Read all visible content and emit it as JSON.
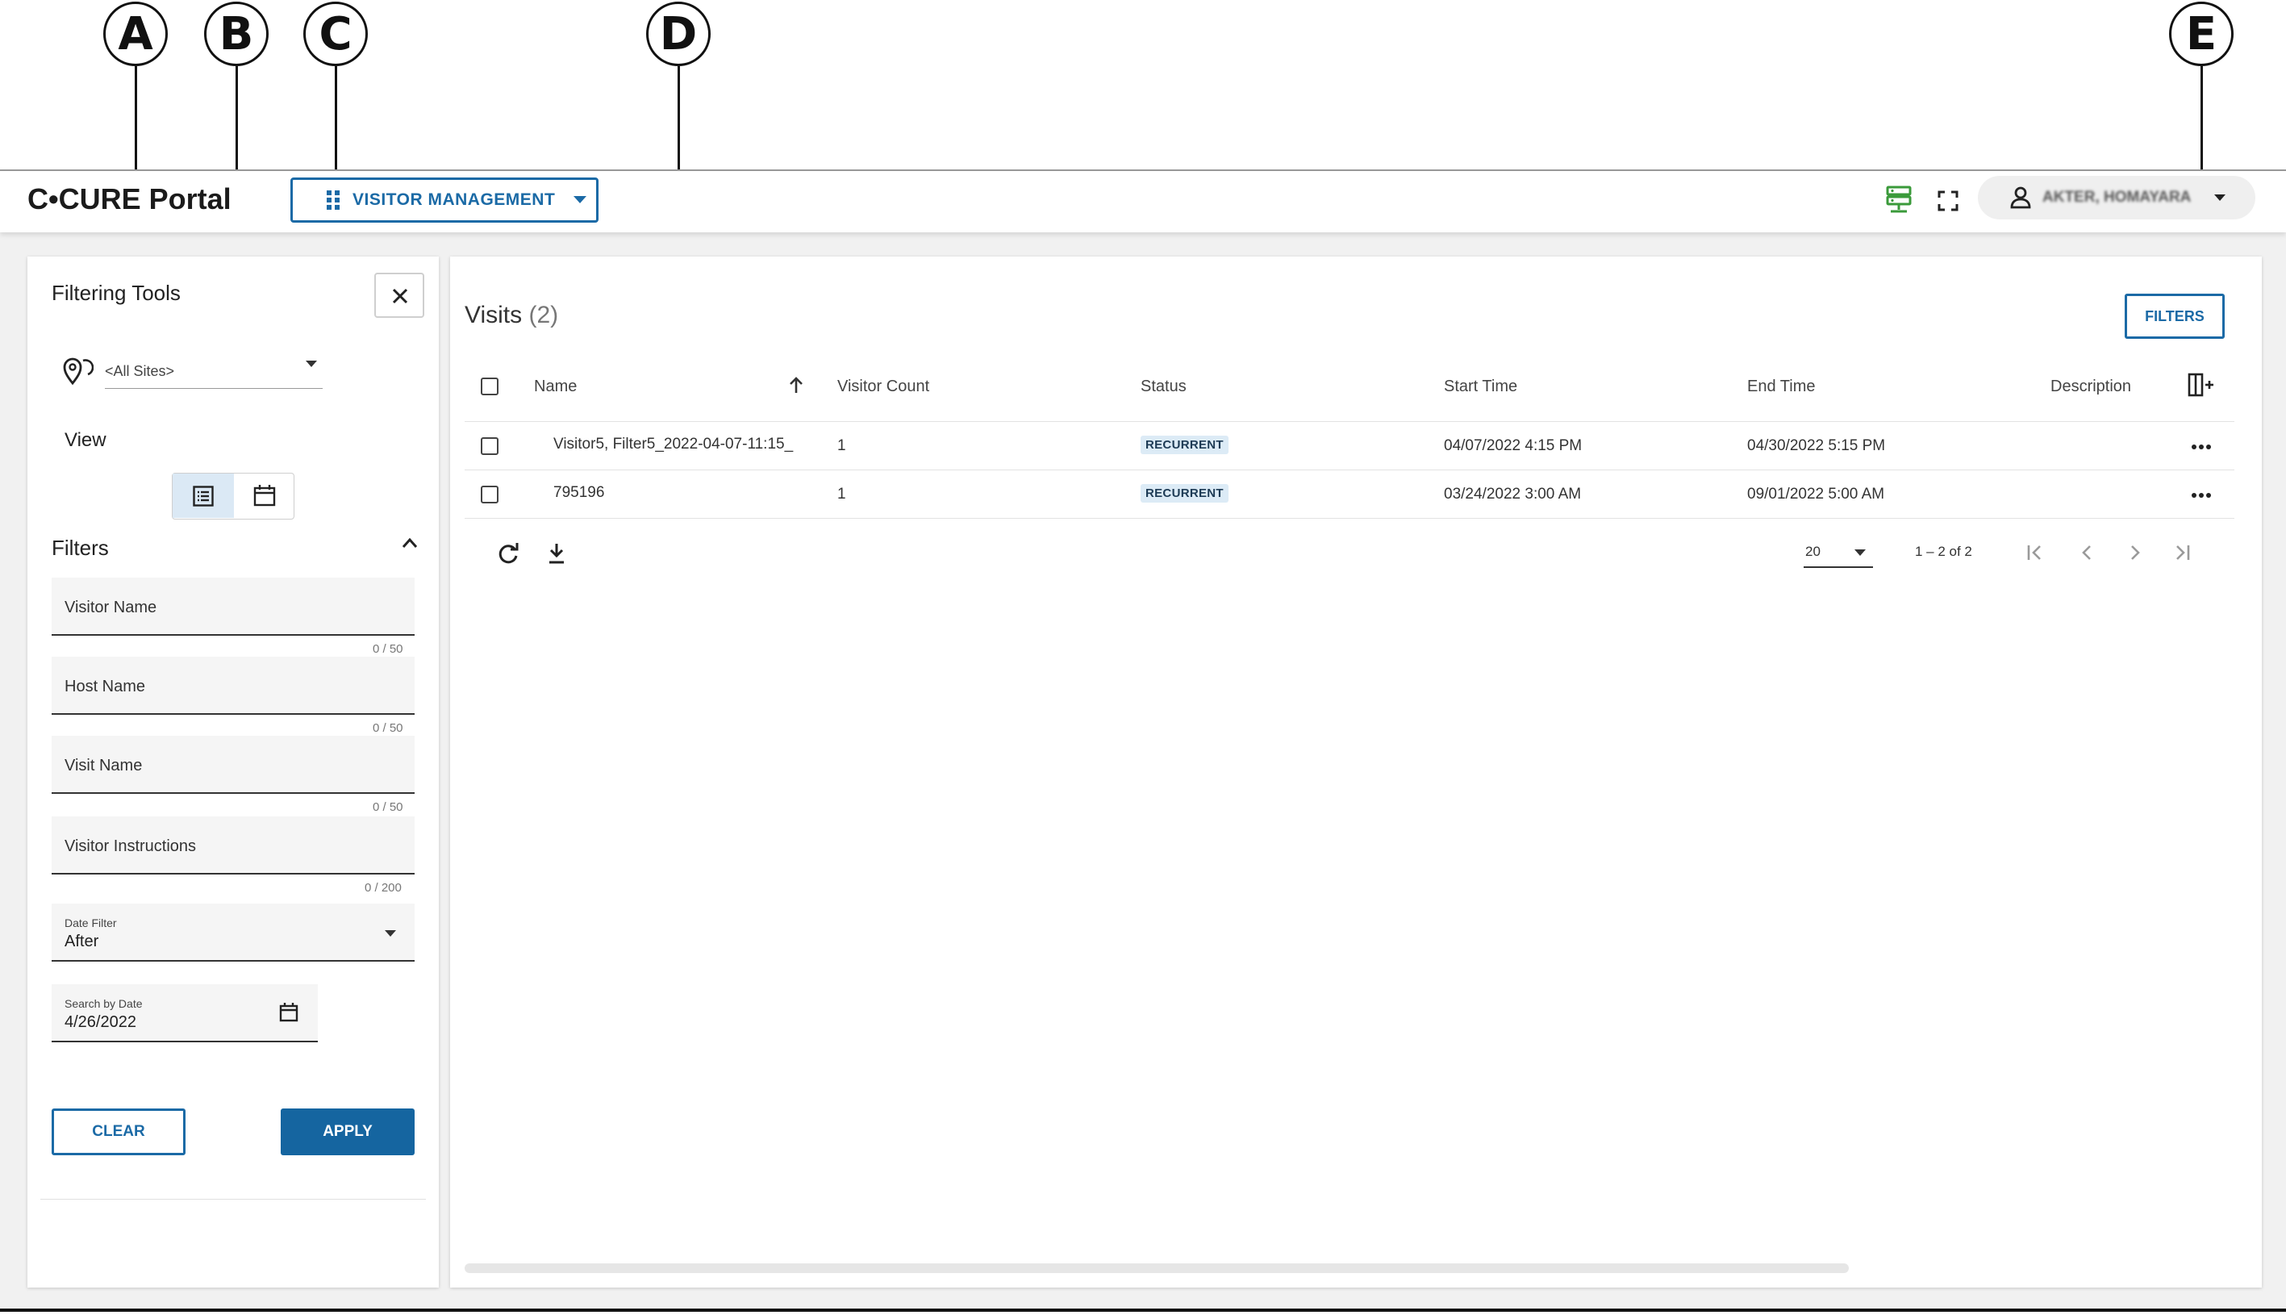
{
  "callouts": [
    "A",
    "B",
    "C",
    "D",
    "E"
  ],
  "header": {
    "logo": "C•CURE Portal",
    "module_button": "VISITOR MANAGEMENT",
    "user_name": "AKTER, HOMAYARA"
  },
  "sidebar": {
    "title": "Filtering Tools",
    "site_select": "<All Sites>",
    "view_label": "View",
    "filters_label": "Filters",
    "fields": [
      {
        "placeholder": "Visitor Name",
        "counter": "0 / 50"
      },
      {
        "placeholder": "Host Name",
        "counter": "0 / 50"
      },
      {
        "placeholder": "Visit Name",
        "counter": "0 / 50"
      },
      {
        "placeholder": "Visitor Instructions",
        "counter": "0 / 200"
      }
    ],
    "date_filter": {
      "label": "Date Filter",
      "value": "After"
    },
    "search_by_date": {
      "label": "Search by Date",
      "value": "4/26/2022"
    },
    "clear_button": "CLEAR",
    "apply_button": "APPLY"
  },
  "main": {
    "title": "Visits",
    "count": "(2)",
    "filters_button": "FILTERS",
    "columns": [
      "Name",
      "Visitor Count",
      "Status",
      "Start Time",
      "End Time",
      "Description"
    ],
    "rows": [
      {
        "name": "Visitor5, Filter5_2022-04-07-11:15_",
        "visitor_count": "1",
        "status": "RECURRENT",
        "start": "04/07/2022 4:15 PM",
        "end": "04/30/2022 5:15 PM"
      },
      {
        "name": "795196",
        "visitor_count": "1",
        "status": "RECURRENT",
        "start": "03/24/2022 3:00 AM",
        "end": "09/01/2022 5:00 AM"
      }
    ],
    "pagination": {
      "page_size": "20",
      "range": "1 – 2 of 2"
    }
  },
  "colors": {
    "accent": "#1b6aa6",
    "primary_button": "#1565a0",
    "status_icon": "#3a9a3a",
    "badge_bg": "#dcebf6"
  }
}
